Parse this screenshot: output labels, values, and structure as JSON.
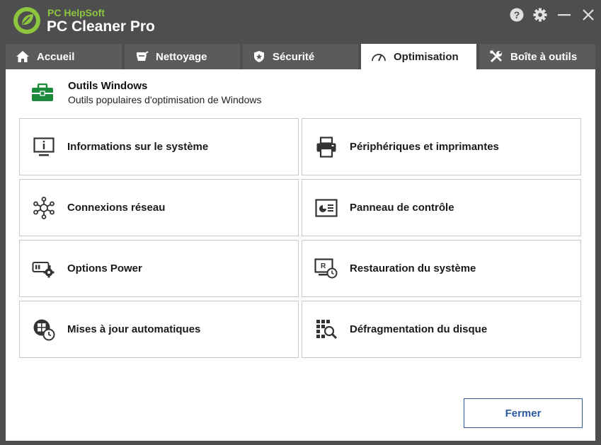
{
  "app": {
    "brand_small": "PC HelpSoft",
    "brand_big": "PC Cleaner Pro",
    "brand_green": "#8cc63f",
    "background": "#4e4e4e"
  },
  "window_controls": {
    "help_icon": "help-icon",
    "settings_icon": "gear-icon",
    "minimize_icon": "minimize-icon",
    "close_icon": "close-icon"
  },
  "tabs": [
    {
      "label": "Accueil",
      "icon": "home-icon",
      "active": false
    },
    {
      "label": "Nettoyage",
      "icon": "cleaning-icon",
      "active": false
    },
    {
      "label": "Sécurité",
      "icon": "shield-icon",
      "active": false
    },
    {
      "label": "Optimisation",
      "icon": "speedometer-icon",
      "active": true
    },
    {
      "label": "Boîte à outils",
      "icon": "tools-icon",
      "active": false
    }
  ],
  "section": {
    "title": "Outils Windows",
    "subtitle": "Outils populaires d'optimisation de Windows",
    "icon": "toolbox-icon"
  },
  "tools": [
    {
      "label": "Informations sur le système",
      "icon": "monitor-info-icon"
    },
    {
      "label": "Périphériques et imprimantes",
      "icon": "printer-icon"
    },
    {
      "label": "Connexions réseau",
      "icon": "network-icon"
    },
    {
      "label": "Panneau de contrôle",
      "icon": "control-panel-icon"
    },
    {
      "label": "Options Power",
      "icon": "power-options-icon"
    },
    {
      "label": "Restauration du système",
      "icon": "system-restore-icon"
    },
    {
      "label": "Mises à jour automatiques",
      "icon": "windows-update-icon"
    },
    {
      "label": "Défragmentation du disque",
      "icon": "defrag-icon"
    }
  ],
  "footer": {
    "close_label": "Fermer",
    "accent": "#2b5aa0"
  }
}
